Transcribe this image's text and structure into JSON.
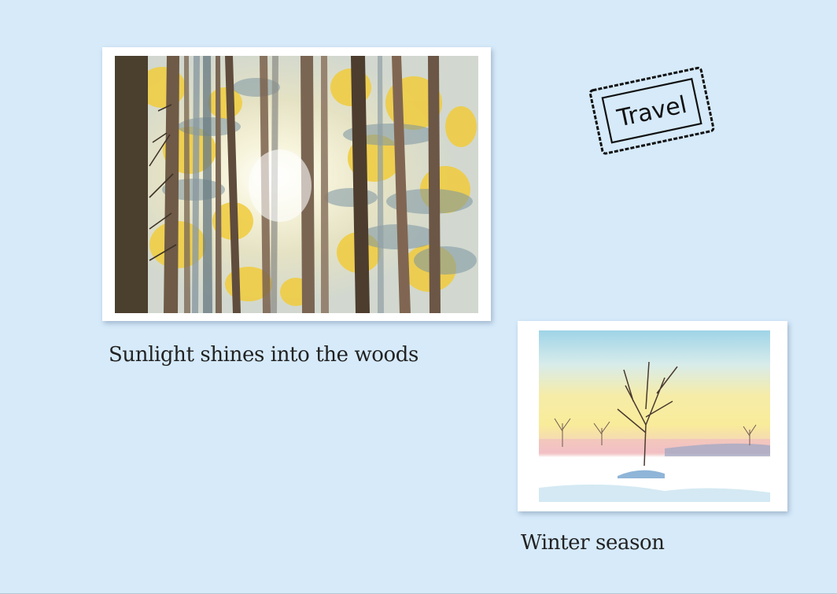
{
  "photos": [
    {
      "caption": "Sunlight shines into the woods"
    },
    {
      "caption": "Winter season"
    }
  ],
  "stamp": {
    "text": "Travel"
  },
  "colors": {
    "background": "#d6eafa",
    "card": "#ffffff",
    "text": "#222222"
  }
}
